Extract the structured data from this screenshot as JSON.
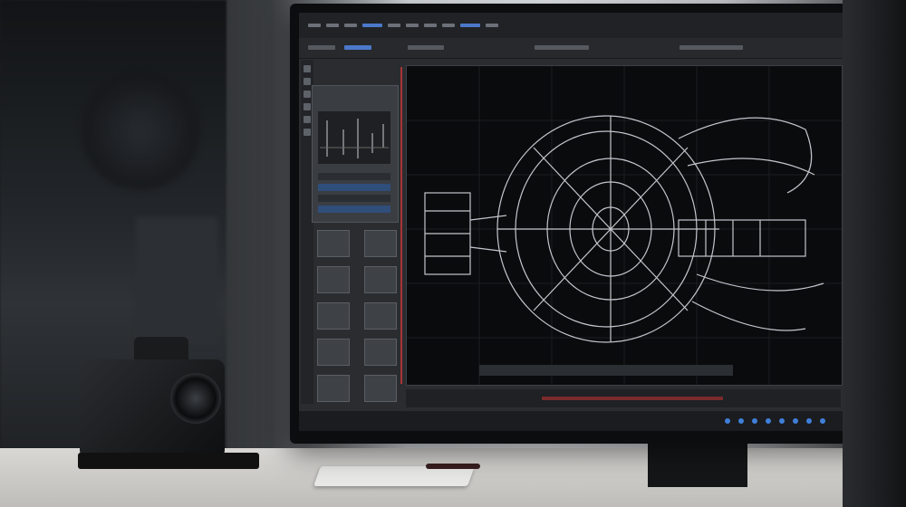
{
  "scene": {
    "description_labels": {
      "camera": "camera",
      "monitor": "monitor",
      "viewport": "3d-wireframe-model"
    }
  },
  "colors": {
    "accent": "#4b78c9",
    "wireframe": "#d6dbe2",
    "timeline_red": "#a33333",
    "status_blue": "#3f7fd9",
    "panel_green": "#3b8f4a"
  },
  "icons": {
    "menu": "menu-icon",
    "tool": "tool-icon",
    "thumbnail": "thumbnail-icon"
  }
}
